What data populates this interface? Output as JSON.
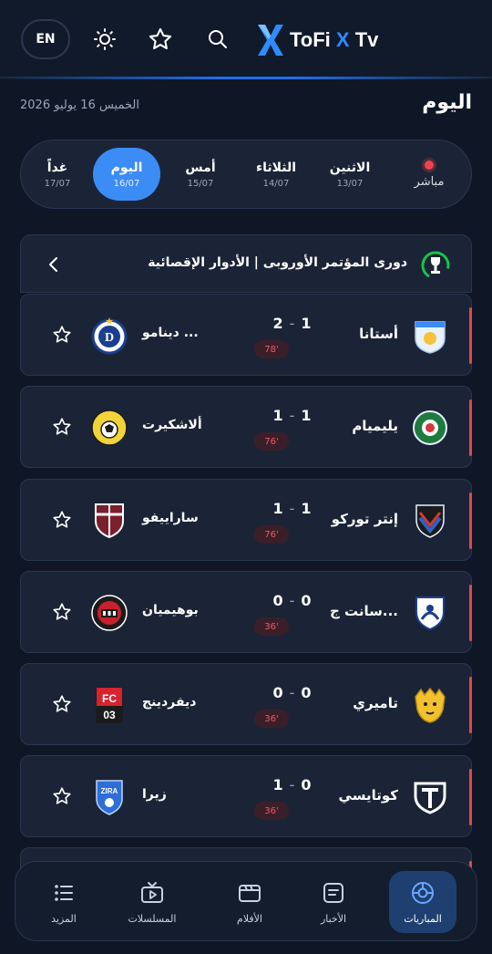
{
  "header": {
    "lang_label": "EN",
    "brand_part1": "ToFi ",
    "brand_x": "X",
    "brand_part2": " Tv"
  },
  "date_text": "الخميس 16 يوليو 2026",
  "page_title": "اليوم",
  "day_tabs": [
    {
      "name": "مباشر",
      "date": ""
    },
    {
      "name": "الاثنين",
      "date": "13/07"
    },
    {
      "name": "الثلاثاء",
      "date": "14/07"
    },
    {
      "name": "أمس",
      "date": "15/07"
    },
    {
      "name": "اليوم",
      "date": "16/07"
    },
    {
      "name": "غداً",
      "date": "17/07"
    }
  ],
  "league": {
    "name": "دورى المؤتمر الأوروبى | الأدوار الإقصائية"
  },
  "matches": [
    {
      "home": "أستانا",
      "away": "دينامو ...",
      "home_score": "1",
      "away_score": "2",
      "minute": "78'"
    },
    {
      "home": "يليميام",
      "away": "ألاشكيرت",
      "home_score": "1",
      "away_score": "1",
      "minute": "76'"
    },
    {
      "home": "إنتر توركو",
      "away": "ساراييفو",
      "home_score": "1",
      "away_score": "1",
      "minute": "76'"
    },
    {
      "home": "سانت ج...",
      "away": "بوهيميان",
      "home_score": "0",
      "away_score": "0",
      "minute": "36'"
    },
    {
      "home": "تاميري",
      "away": "ديفردينج",
      "home_score": "0",
      "away_score": "0",
      "minute": "36'"
    },
    {
      "home": "كوتايسي",
      "away": "زيرا",
      "home_score": "0",
      "away_score": "1",
      "minute": "36'"
    }
  ],
  "bottom_nav": [
    {
      "label": "المباريات",
      "icon": "football-icon"
    },
    {
      "label": "الأخبار",
      "icon": "news-icon"
    },
    {
      "label": "الأفلام",
      "icon": "film-icon"
    },
    {
      "label": "المسلسلات",
      "icon": "tv-icon"
    },
    {
      "label": "المزيد",
      "icon": "more-list-icon"
    }
  ],
  "colors": {
    "accent": "#3b8cf5",
    "live": "#e6454f",
    "background": "#0f1726",
    "card": "#1b2436"
  }
}
